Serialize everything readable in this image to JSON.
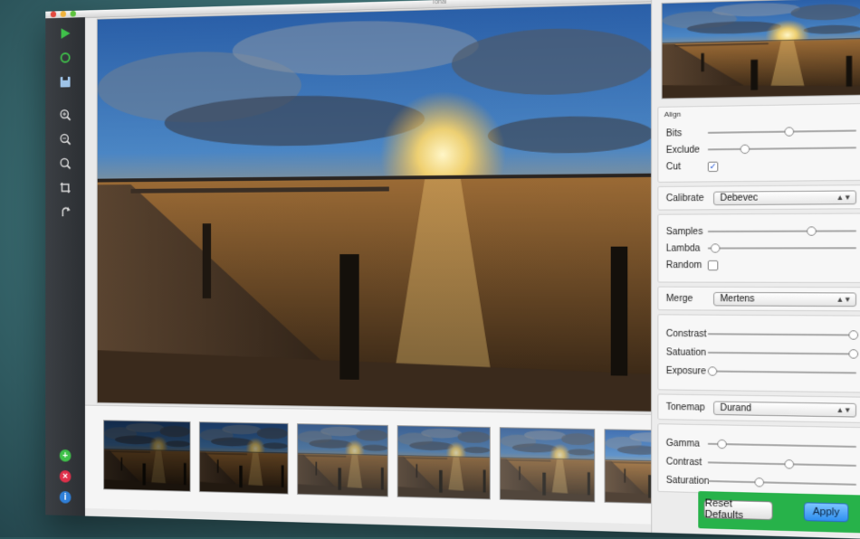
{
  "window": {
    "title": "Tonal"
  },
  "toolbar": {
    "icons": [
      "play-icon",
      "refresh-icon",
      "save-icon",
      "zoom-in-icon",
      "zoom-out-icon",
      "zoom-fit-icon",
      "crop-icon",
      "rotate-icon"
    ],
    "bottom_icons": [
      "add-icon",
      "remove-icon",
      "info-icon"
    ]
  },
  "align": {
    "title": "Align",
    "bits_label": "Bits",
    "bits_value": 0.55,
    "exclude_label": "Exclude",
    "exclude_value": 0.25,
    "cut_label": "Cut",
    "cut_checked": true
  },
  "calibrate": {
    "label": "Calibrate",
    "value": "Debevec"
  },
  "samples": {
    "samples_label": "Samples",
    "samples_value": 0.7,
    "lambda_label": "Lambda",
    "lambda_value": 0.05,
    "random_label": "Random",
    "random_checked": false
  },
  "merge": {
    "label": "Merge",
    "value": "Mertens"
  },
  "merge_params": {
    "contrast_label": "Constrast",
    "contrast_value": 0.98,
    "saturation_label": "Satuation",
    "saturation_value": 0.98,
    "exposure_label": "Exposure",
    "exposure_value": 0.03
  },
  "tonemap": {
    "label": "Tonemap",
    "value": "Durand"
  },
  "tonemap_params": {
    "gamma_label": "Gamma",
    "gamma_value": 0.1,
    "contrast_label": "Contrast",
    "contrast_value": 0.55,
    "saturation_label": "Saturation",
    "saturation_value": 0.35
  },
  "footer": {
    "reset_label": "Reset Defaults",
    "apply_label": "Apply"
  },
  "colors": {
    "accent_green": "#27b24a",
    "apply_blue": "#2f8ff0",
    "toolbar_dark": "#2c2f33"
  }
}
